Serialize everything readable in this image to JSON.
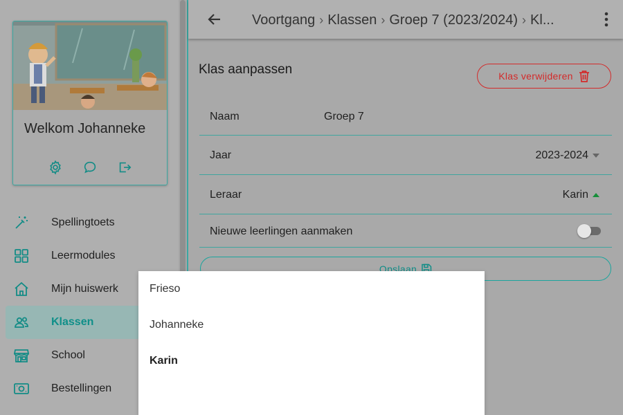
{
  "sidebar": {
    "welcome": "Welkom Johanneke",
    "nav": [
      {
        "label": "Spellingtoets",
        "icon": "magic-wand-icon",
        "active": false
      },
      {
        "label": "Leermodules",
        "icon": "grid-icon",
        "active": false
      },
      {
        "label": "Mijn huiswerk",
        "icon": "home-icon",
        "active": false
      },
      {
        "label": "Klassen",
        "icon": "users-icon",
        "active": true
      },
      {
        "label": "School",
        "icon": "storefront-icon",
        "active": false
      },
      {
        "label": "Bestellingen",
        "icon": "money-icon",
        "active": false
      }
    ]
  },
  "topbar": {
    "breadcrumb": [
      "Voortgang",
      "Klassen",
      "Groep 7 (2023/2024)",
      "Kl..."
    ]
  },
  "form": {
    "title": "Klas aanpassen",
    "delete_label": "Klas verwijderen",
    "name_label": "Naam",
    "name_value": "Groep 7",
    "year_label": "Jaar",
    "year_value": "2023-2024",
    "teacher_label": "Leraar",
    "teacher_value": "Karin",
    "new_students_label": "Nieuwe leerlingen aanmaken",
    "new_students_enabled": false,
    "save_label": "Opslaan"
  },
  "teacher_menu": {
    "options": [
      "Frieso",
      "Johanneke",
      "Karin"
    ],
    "selected": "Karin"
  },
  "colors": {
    "accent": "#17a7a0",
    "danger": "#d32a2a",
    "active_up": "#168f3a"
  }
}
